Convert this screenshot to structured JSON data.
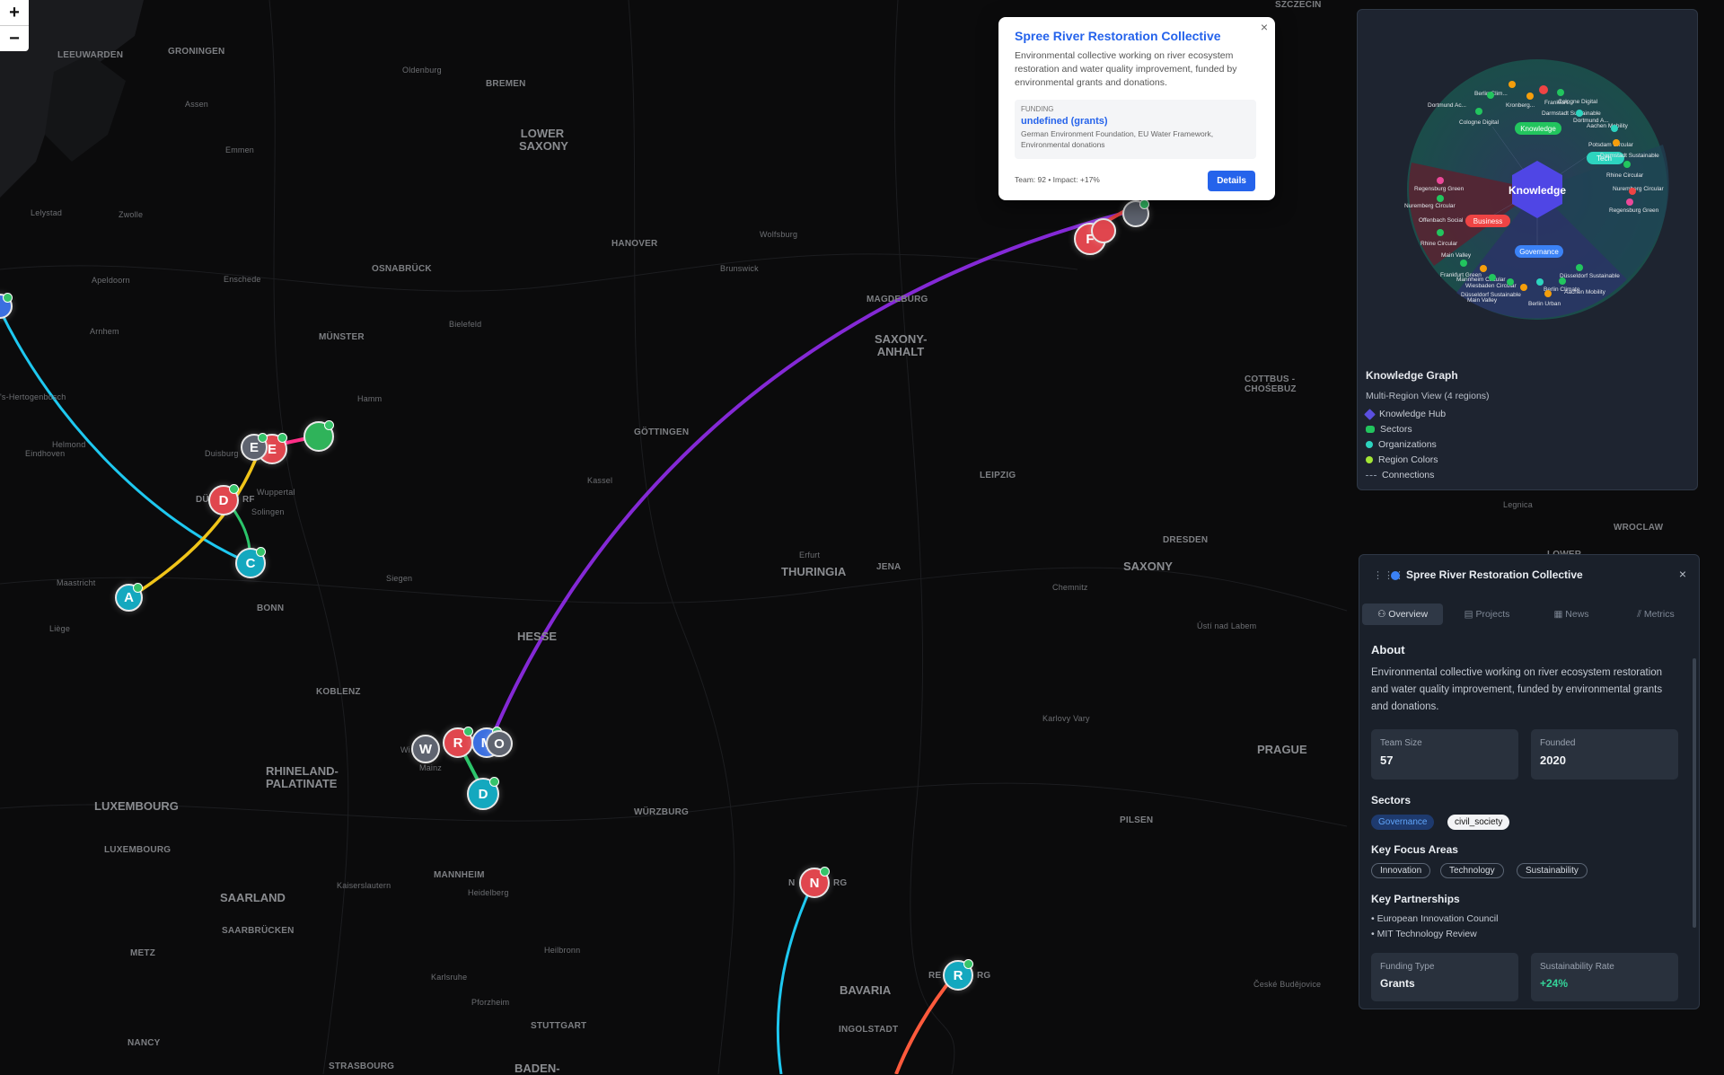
{
  "zoom": {
    "in_label": "+",
    "out_label": "−"
  },
  "cities": {
    "leeuwarden": "LEEUWARDEN",
    "groningen": "GRONINGEN",
    "oldenburg": "Oldenburg",
    "bremen": "BREMEN",
    "assen": "Assen",
    "emmen": "Emmen",
    "lower_saxony": "LOWER\nSAXONY",
    "lelystad": "Lelystad",
    "zwolle": "Zwolle",
    "hanover": "HANOVER",
    "wolfsburg": "Wolfsburg",
    "brunswick": "Brunswick",
    "apeldoorn": "Apeldoorn",
    "enschede": "Enschede",
    "osnabruck": "OSNABRÜCK",
    "magdeburg": "MAGDEBURG",
    "saxony_anhalt": "SAXONY-\nANHALT",
    "arnhem": "Arnhem",
    "munster": "MÜNSTER",
    "bielefeld": "Bielefeld",
    "hamm": "Hamm",
    "hertogenbosch": "'s-Hertogenbosch",
    "helmond": "Helmond",
    "eindhoven": "Eindhoven",
    "duisburg": "Duisburg",
    "gottingen": "GÖTTINGEN",
    "cottbus": "COTTBUS -\nCHOŚEBUZ",
    "wuppertal": "Wuppertal",
    "solingen": "Solingen",
    "kassel": "Kassel",
    "leipzig": "LEIPZIG",
    "legnica": "Legnica",
    "wroclaw": "WROCLAW",
    "dresden": "DRESDEN",
    "erfurt": "Erfurt",
    "thuringia": "THURINGIA",
    "jena": "JENA",
    "saxony": "SAXONY",
    "maastricht": "Maastricht",
    "siegen": "Siegen",
    "bonn": "BONN",
    "chemnitz": "Chemnitz",
    "liege": "Liège",
    "hesse": "HESSE",
    "usti": "Ústí nad Labem",
    "koblenz": "KOBLENZ",
    "karlovy": "Karlovy Vary",
    "rhineland": "RHINELAND-\nPALATINATE",
    "mainz": "Mainz",
    "prague": "PRAGUE",
    "luxembourg_region": "LUXEMBOURG",
    "wurzburg": "WÜRZBURG",
    "pilsen": "PILSEN",
    "luxembourg": "LUXEMBOURG",
    "mannheim": "MANNHEIM",
    "kaiserslautern": "Kaiserslautern",
    "heidelberg": "Heidelberg",
    "saarland": "SAARLAND",
    "saarbrucken": "SAARBRÜCKEN",
    "metz": "METZ",
    "heilbronn": "Heilbronn",
    "karlsruhe": "Karlsruhe",
    "bavaria": "BAVARIA",
    "ceske": "České Budějovice",
    "pforzheim": "Pforzheim",
    "ingolstadt": "INGOLSTADT",
    "nancy": "NANCY",
    "stuttgart": "STUTTGART",
    "strasbourg": "STRASBOURG",
    "baden": "BADEN-",
    "szczecin": "SZCZECIN",
    "lower_pl": "LOWER",
    "cologne_frag": "C",
    "dusseldorf_frag": "DÜ",
    "dusseldorf_frag2": "RF",
    "wiesbaden_frag": "Wi",
    "nurnberg_frag": "N",
    "nurnberg_frag2": "RG",
    "regensburg_frag": "RE",
    "regensburg_frag2": "RG"
  },
  "markers": [
    {
      "letter": "E",
      "color": "#e0464e"
    },
    {
      "letter": "E",
      "color": "#5f6470"
    },
    {
      "letter": "",
      "color": "#2fb35a"
    },
    {
      "letter": "D",
      "color": "#e0464e"
    },
    {
      "letter": "C",
      "color": "#14a8bf"
    },
    {
      "letter": "A",
      "color": "#14a8bf"
    },
    {
      "letter": "W",
      "color": "#5f6470"
    },
    {
      "letter": "R",
      "color": "#e0464e"
    },
    {
      "letter": "M",
      "color": "#3b6fe0"
    },
    {
      "letter": "O",
      "color": "#5f6470"
    },
    {
      "letter": "D",
      "color": "#14a8bf"
    },
    {
      "letter": "N",
      "color": "#e0464e"
    },
    {
      "letter": "R",
      "color": "#14a8bf"
    },
    {
      "letter": "F",
      "color": "#e0464e"
    },
    {
      "letter": "",
      "color": "#5f6470"
    },
    {
      "letter": "",
      "color": "#e0464e"
    },
    {
      "letter": "",
      "color": "#3b6fe0"
    }
  ],
  "popup": {
    "title": "Spree River Restoration Collective",
    "description": "Environmental collective working on river ecosystem restoration and water quality improvement, funded by environmental grants and donations.",
    "funding_label": "FUNDING",
    "funding_value": "undefined (grants)",
    "funding_sources": "German Environment Foundation, EU Water Framework, Environmental donations",
    "footer": "Team: 92 • Impact: +17%",
    "button": "Details",
    "close": "×"
  },
  "knowledge_graph": {
    "hub_label": "Knowledge",
    "sector_labels": [
      "Knowledge",
      "Tech",
      "Business",
      "Governance"
    ],
    "node_labels": [
      "Berlin Clim...",
      "Dortmund Ac...",
      "Kronberg...",
      "Frankfurt...",
      "Cologne Digital",
      "Darmstadt Sustainable",
      "Cologne Digital",
      "Dortmund A...",
      "Aachen Mobility",
      "Potsdam Circular",
      "Darmstadt Sustainable",
      "Rhine Circular",
      "Nuremberg Circular",
      "Regensburg Green",
      "Regensburg Green",
      "Nuremberg Circular",
      "Offenbach Social",
      "Rhine Circular",
      "Main Valley",
      "Frankfurt Green",
      "Mannheim Circular",
      "Wiesbaden Circular",
      "Düsseldorf Sustainable",
      "Düsseldorf Sustainable",
      "Berlin Climate",
      "Aachen Mobility",
      "Main Valley",
      "Berlin Urban"
    ],
    "title": "Knowledge Graph",
    "subtitle": "Multi-Region View (4 regions)",
    "legend": [
      {
        "label": "Knowledge Hub",
        "color": "#5b4fe0"
      },
      {
        "label": "Sectors",
        "color": "#22c55e"
      },
      {
        "label": "Organizations",
        "color": "#2dd4bf"
      },
      {
        "label": "Region Colors",
        "color": "#a3e635"
      },
      {
        "label": "Connections",
        "color": "#8a94a3"
      }
    ]
  },
  "details": {
    "grip": "⋮⋮⋮",
    "name": "Spree River Restoration Collective",
    "close": "×",
    "tabs": [
      "Overview",
      "Projects",
      "News",
      "Metrics"
    ],
    "tab_icons": [
      "user-icon",
      "document-icon",
      "news-icon",
      "metrics-icon"
    ],
    "about_heading": "About",
    "about_text": "Environmental collective working on river ecosystem restoration and water quality improvement, funded by environmental grants and donations.",
    "team_size_label": "Team Size",
    "team_size": "57",
    "founded_label": "Founded",
    "founded": "2020",
    "sectors_heading": "Sectors",
    "sectors": [
      "Governance",
      "civil_society"
    ],
    "focus_heading": "Key Focus Areas",
    "focus": [
      "Innovation",
      "Technology",
      "Sustainability"
    ],
    "partnerships_heading": "Key Partnerships",
    "partnerships": [
      "• European Innovation Council",
      "• MIT Technology Review"
    ],
    "funding_type_label": "Funding Type",
    "funding_type": "Grants",
    "sustainability_label": "Sustainability Rate",
    "sustainability": "+24%"
  },
  "colors": {
    "accent": "#2563eb",
    "purple_arc": "#8b2be2",
    "cyan_arc": "#1ec8f0",
    "yellow_arc": "#f0c419",
    "green_arc": "#2bc46a",
    "magenta_arc": "#ff2d86",
    "orange_arc": "#ff5a3c"
  }
}
